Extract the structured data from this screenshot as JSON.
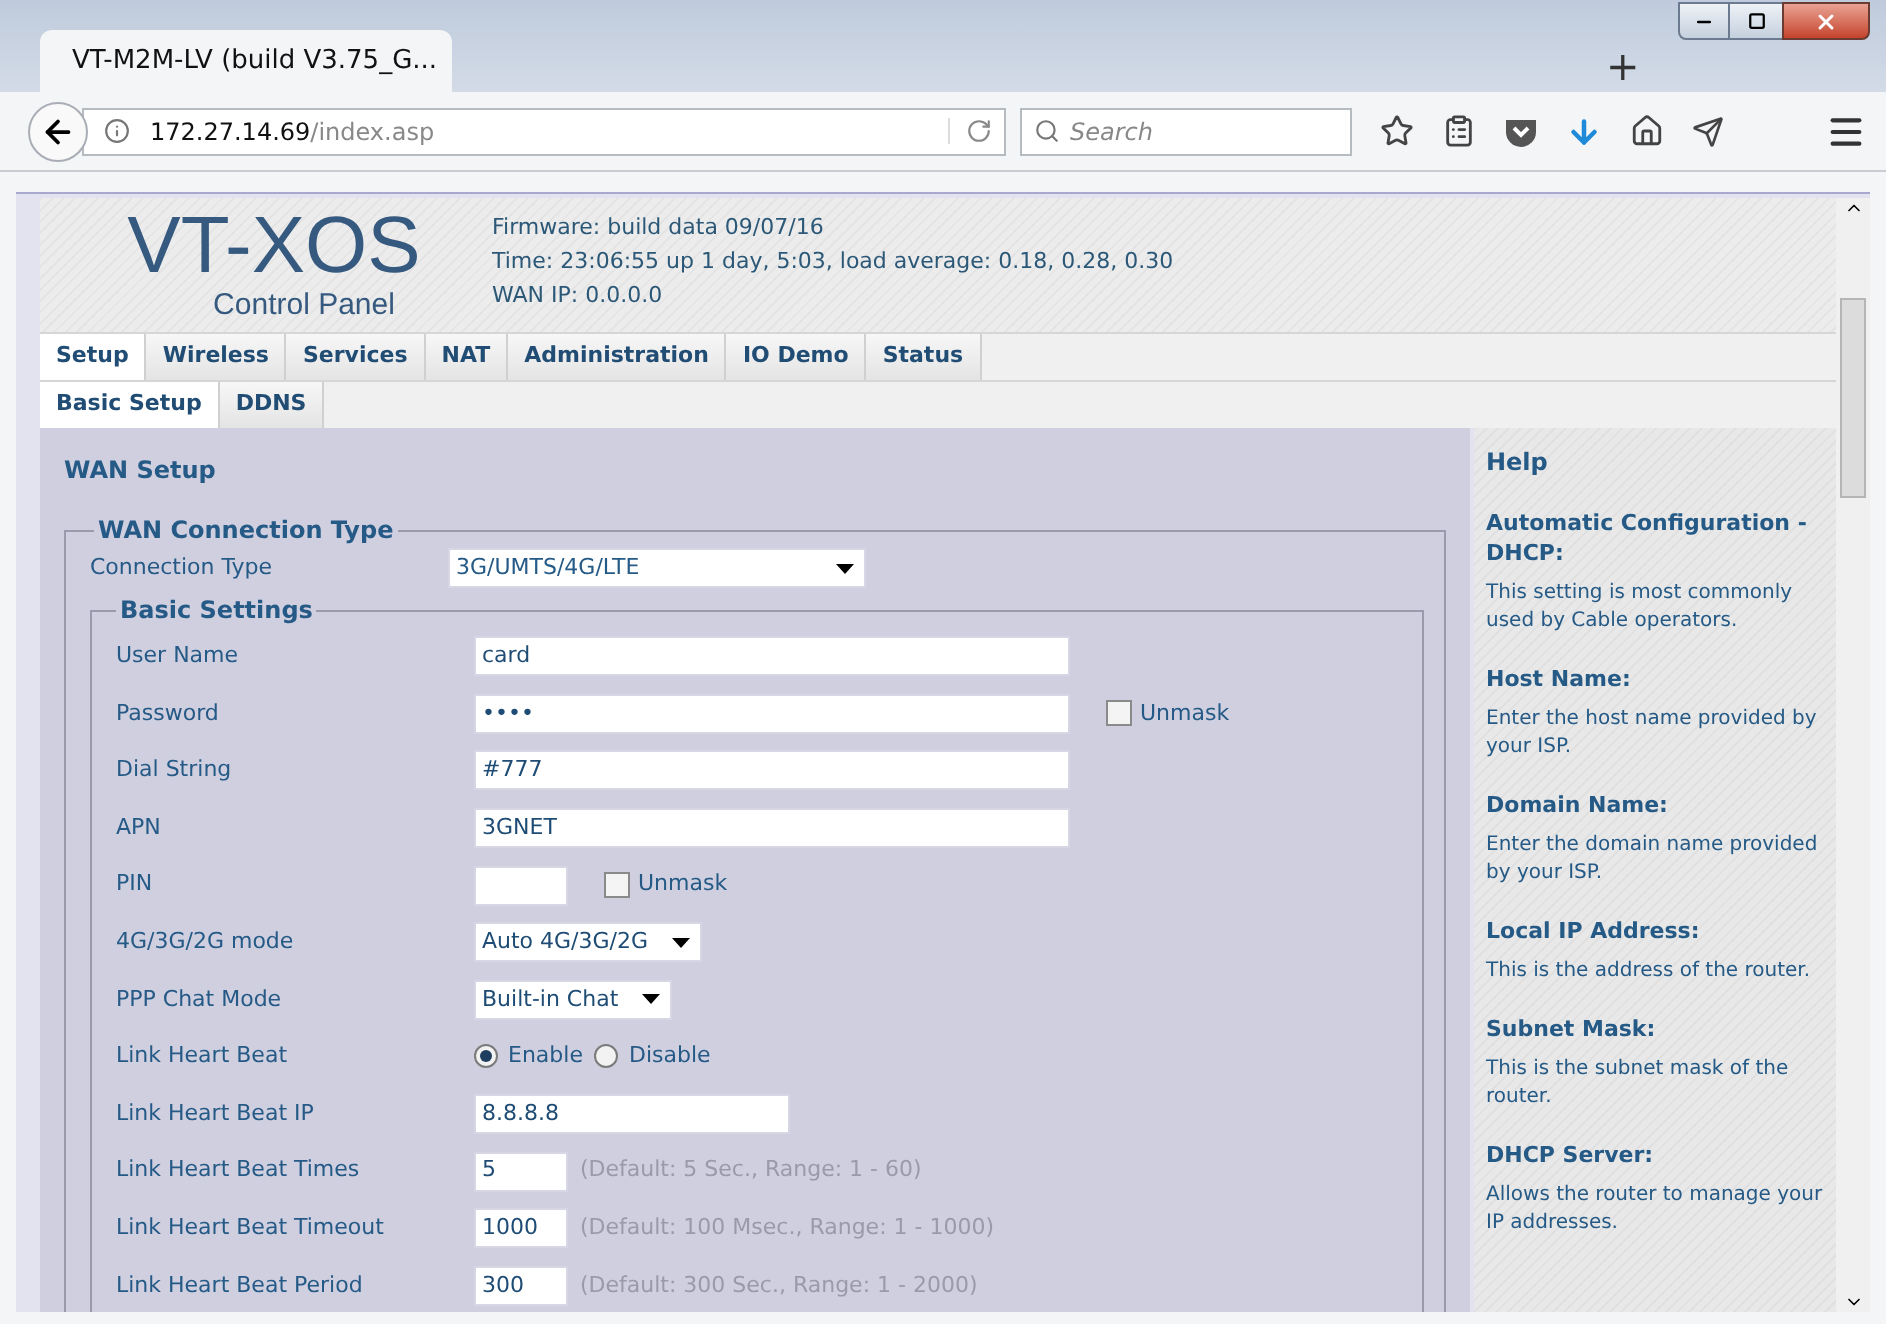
{
  "browser": {
    "tab_title": "VT-M2M-LV (build V3.75_G...",
    "new_tab": "+",
    "address_host": "172.27.14.69",
    "address_path": "/index.asp",
    "search_placeholder": "Search"
  },
  "header": {
    "logo_title": "VT-XOS",
    "logo_subtitle": "Control Panel",
    "info": [
      "Firmware: build data 09/07/16",
      "Time: 23:06:55 up 1 day, 5:03, load average: 0.18, 0.28, 0.30",
      "WAN IP: 0.0.0.0"
    ]
  },
  "main_tabs": [
    {
      "label": "Setup",
      "selected": true
    },
    {
      "label": "Wireless",
      "selected": false
    },
    {
      "label": "Services",
      "selected": false
    },
    {
      "label": "NAT",
      "selected": false
    },
    {
      "label": "Administration",
      "selected": false
    },
    {
      "label": "IO Demo",
      "selected": false
    },
    {
      "label": "Status",
      "selected": false
    }
  ],
  "sub_tabs": [
    {
      "label": "Basic Setup",
      "selected": true
    },
    {
      "label": "DDNS",
      "selected": false
    }
  ],
  "section_title": "WAN Setup",
  "wan_fieldset": {
    "legend": "WAN Connection Type",
    "connection_type": {
      "label": "Connection Type",
      "value": "3G/UMTS/4G/LTE"
    }
  },
  "basic_settings": {
    "legend": "Basic Settings",
    "rows": [
      {
        "kind": "wide",
        "label": "User Name",
        "value": "card"
      },
      {
        "kind": "wide",
        "label": "Password",
        "value": "••••",
        "unmask": {
          "label": "Unmask",
          "checked": false
        }
      },
      {
        "kind": "wide",
        "label": "Dial String",
        "value": "#777"
      },
      {
        "kind": "wide",
        "label": "APN",
        "value": "3GNET"
      },
      {
        "kind": "short",
        "label": "PIN",
        "unmask": {
          "label": "Unmask",
          "checked": false
        }
      },
      {
        "kind": "select",
        "label": "4G/3G/2G mode",
        "value": "Auto 4G/3G/2G"
      },
      {
        "kind": "select",
        "label": "PPP Chat Mode",
        "value": "Built-in Chat"
      },
      {
        "kind": "radio",
        "label": "Link Heart Beat",
        "options": [
          {
            "label": "Enable",
            "selected": true
          },
          {
            "label": "Disable",
            "selected": false
          }
        ]
      },
      {
        "kind": "mid",
        "label": "Link Heart Beat IP",
        "value": "8.8.8.8"
      },
      {
        "kind": "short",
        "label": "Link Heart Beat Times",
        "value": "5",
        "hint": "(Default: 5 Sec., Range: 1 - 60)"
      },
      {
        "kind": "short",
        "label": "Link Heart Beat Timeout",
        "value": "1000",
        "hint": "(Default: 100 Msec., Range: 1 - 1000)"
      },
      {
        "kind": "short",
        "label": "Link Heart Beat Period",
        "value": "300",
        "hint": "(Default: 300 Sec., Range: 1 - 2000)"
      }
    ]
  },
  "help": {
    "title": "Help",
    "items": [
      {
        "heading": "Automatic Configuration - DHCP:",
        "text": "This setting is most commonly used by Cable operators."
      },
      {
        "heading": "Host Name:",
        "text": "Enter the host name provided by your ISP."
      },
      {
        "heading": "Domain Name:",
        "text": "Enter the domain name provided by your ISP."
      },
      {
        "heading": "Local IP Address:",
        "text": "This is the address of the router."
      },
      {
        "heading": "**Subnet Mask**:",
        "text": "This is the subnet mask of the router."
      },
      {
        "heading": "**DHCP Server**:",
        "text": "Allows the router to manage your IP addresses."
      }
    ]
  }
}
